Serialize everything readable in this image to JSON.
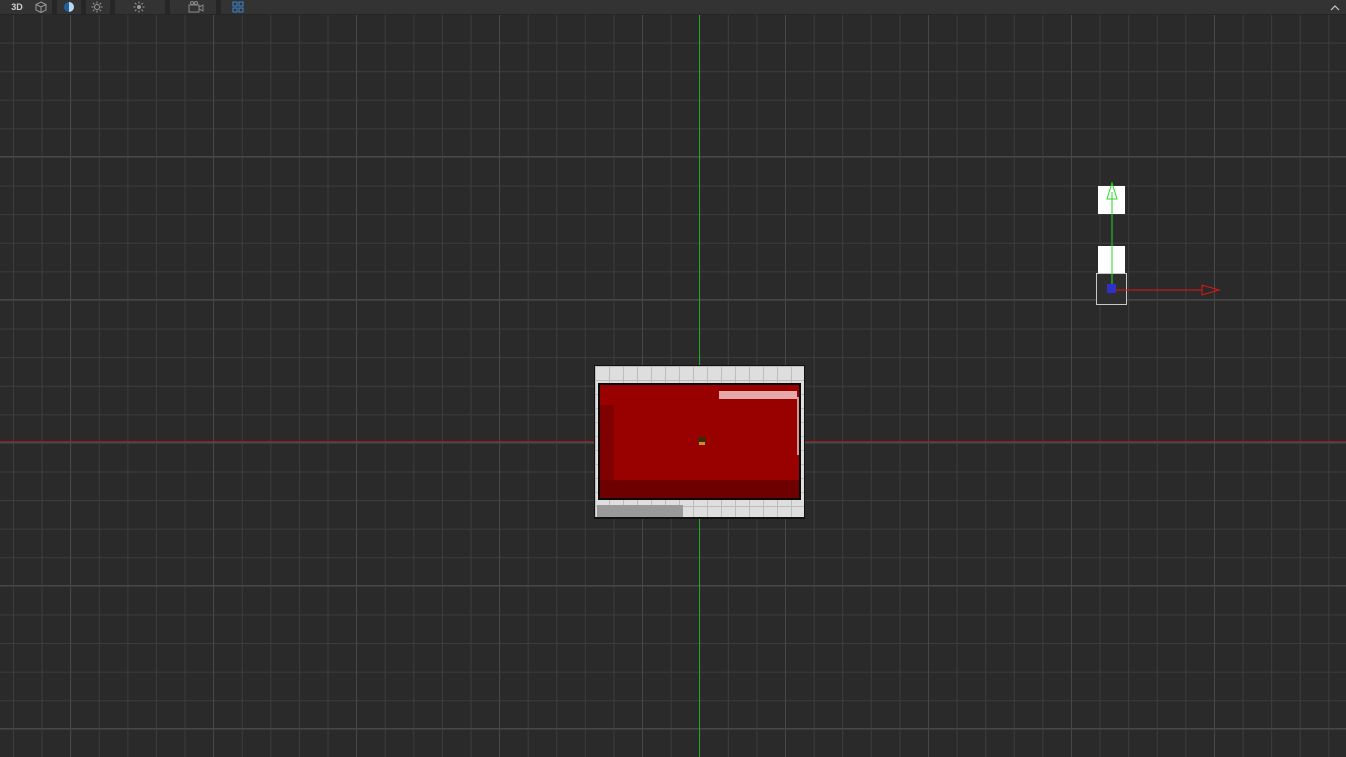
{
  "toolbar": {
    "mode_3d_label": "3D",
    "icons": [
      "cube-icon",
      "shading-icon",
      "lighting-icon",
      "sun-icon",
      "camera-icon",
      "grid-snap-icon",
      "collapse-icon"
    ],
    "collapse_glyph": "^"
  },
  "viewport": {
    "background_color": "#2a2a2a",
    "grid_color": "#3d3d3d",
    "x_axis_color": "#a01c1c",
    "y_axis_color": "#1fa81f"
  },
  "scene": {
    "sprite_color": "#990000",
    "gizmo_x_color": "#e01515",
    "gizmo_y_color": "#2bd62b"
  }
}
